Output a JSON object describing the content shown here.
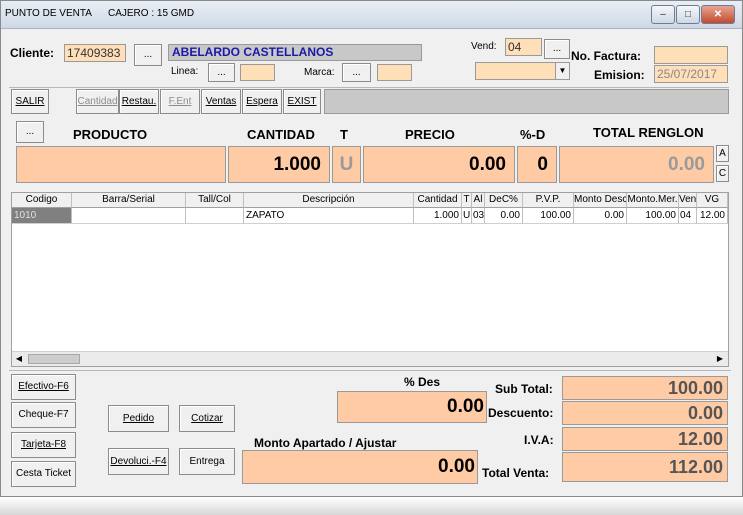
{
  "window": {
    "title": "PUNTO DE VENTA      CAJERO : 15 GMD"
  },
  "header": {
    "cliente_label": "Cliente:",
    "cliente_code": "17409383",
    "cliente_name": "ABELARDO CASTELLANOS",
    "linea_label": "Linea:",
    "marca_label": "Marca:",
    "vend_label": "Vend:",
    "vend_value": "04",
    "factura_label": "No. Factura:",
    "factura_value": "",
    "emision_label": "Emision:",
    "emision_value": "25/07/2017",
    "lookup_label": "..."
  },
  "toolbar": {
    "salir": "SALIR",
    "cantidad": "Cantidad",
    "restau": "Restau.",
    "fent": "F.Ent",
    "ventas": "Ventas",
    "espera": "Espera",
    "exist": "EXIST"
  },
  "entry": {
    "producto_header": "PRODUCTO",
    "cantidad_header": "CANTIDAD",
    "t_header": "T",
    "precio_header": "PRECIO",
    "pd_header": "%-D",
    "total_header": "TOTAL RENGLON",
    "producto_value": "",
    "cantidad_value": "1.000",
    "t_value": "U",
    "precio_value": "0.00",
    "pd_value": "0",
    "total_value": "0.00",
    "side_a": "A",
    "side_c": "C"
  },
  "grid": {
    "columns": [
      "Codigo",
      "Barra/Serial",
      "Tall/Col",
      "Descripción",
      "Cantidad",
      "T",
      "Al",
      "DeC%",
      "P.V.P.",
      "Monto Desc",
      "Monto.Mer.",
      "Ven",
      "VG"
    ],
    "rows": [
      {
        "codigo": "1010",
        "barra": "",
        "tall": "",
        "descripcion": "ZAPATO",
        "cantidad": "1.000",
        "t": "U",
        "al": "03",
        "dec": "0.00",
        "pvp": "100.00",
        "monto_desc": "0.00",
        "monto_mer": "100.00",
        "ven": "04",
        "vg": "12.00"
      }
    ]
  },
  "payments": {
    "efectivo": "Efectivo-F6",
    "cheque": "Cheque-F7",
    "tarjeta": "Tarjeta-F8",
    "cesta": "Cesta Ticket"
  },
  "actions": {
    "pedido": "Pedido",
    "cotizar": "Cotizar",
    "devolucion": "Devoluci.-F4",
    "entrega": "Entrega"
  },
  "summary": {
    "des_label": "% Des",
    "des_value": "0.00",
    "apartado_label": "Monto Apartado / Ajustar",
    "apartado_value": "0.00",
    "subtotal_label": "Sub Total:",
    "subtotal_value": "100.00",
    "descuento_label": "Descuento:",
    "descuento_value": "0.00",
    "iva_label": "I.V.A:",
    "iva_value": "12.00",
    "total_label": "Total Venta:",
    "total_value": "112.00"
  },
  "colors": {
    "field_bg": "#ffdfb8",
    "big_field_bg": "#ffcba4",
    "client_name_color": "#1a1aa8",
    "window_bg": "#f0f0f0"
  }
}
